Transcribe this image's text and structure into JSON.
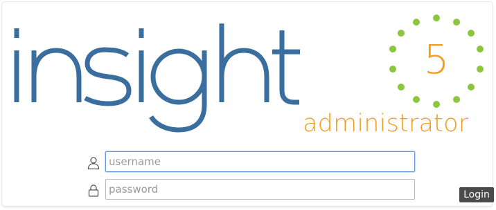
{
  "logo": {
    "word": "insight",
    "version": "5",
    "subtitle": "administrator",
    "colors": {
      "word": "#3a6e9e",
      "accent": "#f39c1a",
      "dots": "#8cc63f"
    }
  },
  "login_form": {
    "username": {
      "icon": "user-icon",
      "placeholder": "username",
      "value": ""
    },
    "password": {
      "icon": "lock-icon",
      "placeholder": "password",
      "value": ""
    },
    "submit_label": "Login"
  }
}
